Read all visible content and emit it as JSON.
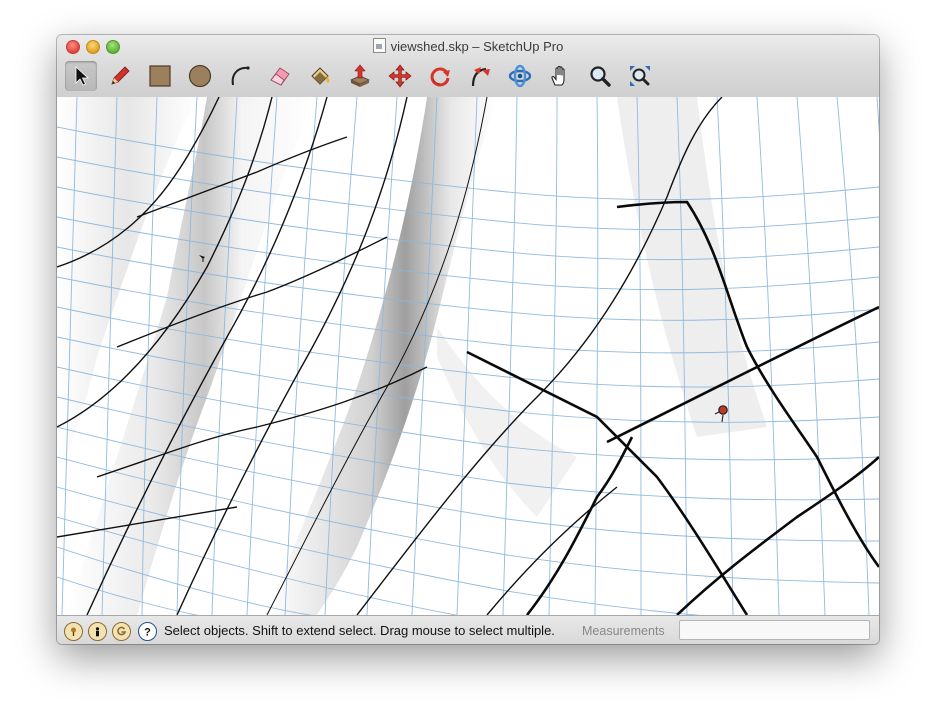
{
  "window": {
    "title": "viewshed.skp – SketchUp Pro"
  },
  "toolbar": {
    "tools": [
      {
        "name": "Select",
        "icon": "select-arrow-icon",
        "active": true
      },
      {
        "name": "Line",
        "icon": "pencil-icon"
      },
      {
        "name": "Rectangle",
        "icon": "rectangle-icon"
      },
      {
        "name": "Circle",
        "icon": "circle-icon"
      },
      {
        "name": "Arc",
        "icon": "arc-icon"
      },
      {
        "name": "Eraser",
        "icon": "eraser-icon"
      },
      {
        "name": "Paint Bucket",
        "icon": "paint-bucket-icon"
      },
      {
        "name": "Push/Pull",
        "icon": "push-pull-icon"
      },
      {
        "name": "Move",
        "icon": "move-icon"
      },
      {
        "name": "Rotate",
        "icon": "rotate-icon"
      },
      {
        "name": "Follow Me",
        "icon": "follow-me-icon"
      },
      {
        "name": "Orbit",
        "icon": "orbit-icon"
      },
      {
        "name": "Pan",
        "icon": "pan-hand-icon"
      },
      {
        "name": "Zoom",
        "icon": "zoom-icon"
      },
      {
        "name": "Zoom Extents",
        "icon": "zoom-extents-icon"
      }
    ]
  },
  "statusbar": {
    "icons": [
      "geo-location-icon",
      "credits-icon",
      "google-account-icon",
      "instructor-help-icon"
    ],
    "message": "Select objects. Shift to extend select. Drag mouse to select multiple.",
    "measurements_label": "Measurements",
    "measurements_value": ""
  },
  "colors": {
    "grid_line": "#8db7dc",
    "contour_line": "#111111",
    "terrain_shade": "#c8c8c8",
    "accent_marker": "#c0392b"
  }
}
